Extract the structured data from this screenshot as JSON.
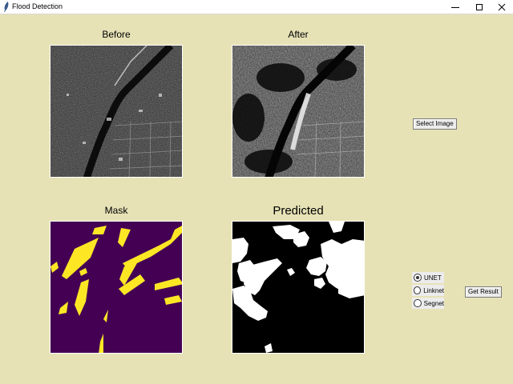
{
  "window": {
    "title": "Flood Detection",
    "controls": [
      "minimize",
      "maximize",
      "close"
    ]
  },
  "panels": {
    "before": {
      "label": "Before"
    },
    "after": {
      "label": "After"
    },
    "mask": {
      "label": "Mask"
    },
    "predicted": {
      "label": "Predicted"
    }
  },
  "buttons": {
    "select_image": "Select Image",
    "get_result": "Get Result"
  },
  "model_options": [
    {
      "label": "UNET",
      "selected": true
    },
    {
      "label": "Linknet",
      "selected": false
    },
    {
      "label": "Segnet",
      "selected": false
    }
  ],
  "colors": {
    "background": "#e6e2b6",
    "mask_background": "#440154",
    "mask_foreground": "#fde725"
  }
}
